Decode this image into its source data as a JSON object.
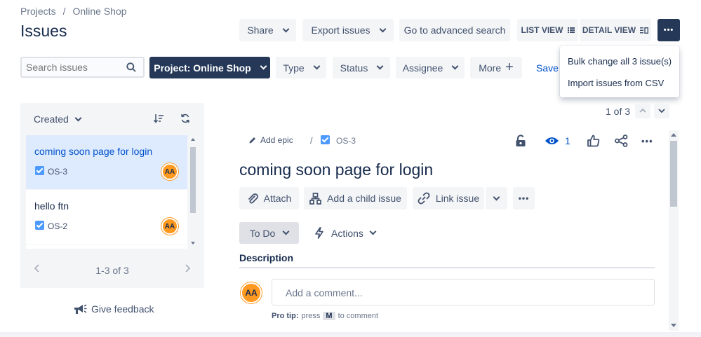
{
  "breadcrumb": {
    "projects": "Projects",
    "separator": "/",
    "project": "Online Shop"
  },
  "page_title": "Issues",
  "toolbar": {
    "share": "Share",
    "export": "Export issues",
    "advanced_search": "Go to advanced search",
    "list_view": "LIST VIEW",
    "detail_view": "DETAIL VIEW",
    "more": "•••"
  },
  "filters": {
    "search_placeholder": "Search issues",
    "project": "Project: Online Shop",
    "type": "Type",
    "status": "Status",
    "assignee": "Assignee",
    "more": "More",
    "save": "Save"
  },
  "dropdown_menu": {
    "items": [
      "Bulk change all 3 issue(s)",
      "Import issues from CSV"
    ]
  },
  "issue_list": {
    "sort_label": "Created",
    "items": [
      {
        "title": "coming soon page for login",
        "key": "OS-3",
        "assignee": "AA",
        "selected": true
      },
      {
        "title": "hello ftn",
        "key": "OS-2",
        "assignee": "AA",
        "selected": false
      }
    ],
    "pagination": "1-3 of 3"
  },
  "feedback": {
    "label": "Give feedback"
  },
  "detail": {
    "counter": "1 of 3",
    "add_epic": "Add epic",
    "separator": "/",
    "issue_key": "OS-3",
    "watchers": "1",
    "title": "coming soon page for login",
    "actions": {
      "attach": "Attach",
      "child_issue": "Add a child issue",
      "link_issue": "Link issue"
    },
    "status": "To Do",
    "workflow_actions": "Actions",
    "description_label": "Description",
    "comment": {
      "avatar": "AA",
      "placeholder": "Add a comment...",
      "pro_tip_label": "Pro tip:",
      "pro_tip_press": "press",
      "pro_tip_key": "M",
      "pro_tip_suffix": "to comment"
    }
  },
  "colors": {
    "primary_dark": "#253858",
    "link_blue": "#0052cc",
    "selected_bg": "#deebff",
    "avatar_orange": "#ff991f"
  }
}
